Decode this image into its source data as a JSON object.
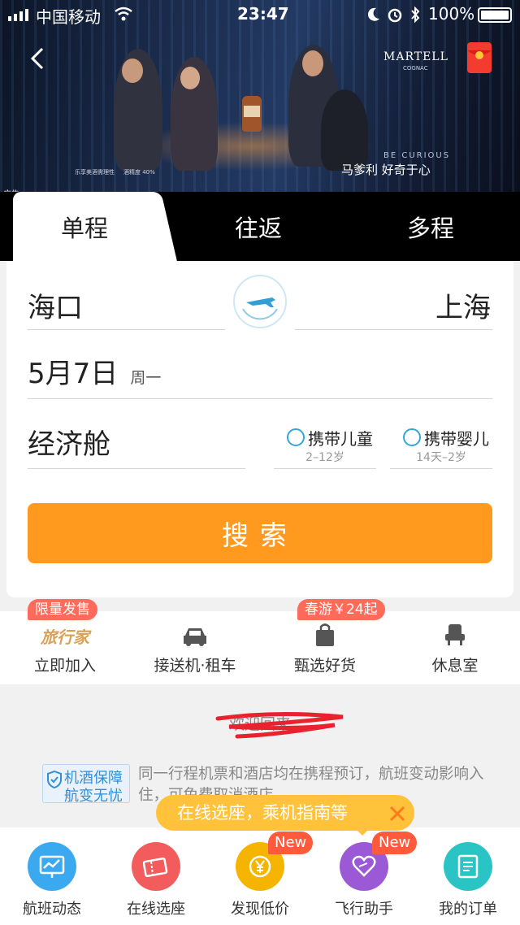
{
  "status_bar": {
    "carrier": "中国移动",
    "time": "23:47",
    "battery": "100%"
  },
  "banner": {
    "brand": "MARTELL",
    "brand_sub": "COGNAC",
    "slogan_en": "BE CURIOUS",
    "slogan_cn": "马爹利 好奇于心",
    "warning": "乐享美酒需理性",
    "abv": "酒精度 40%",
    "ad_tag": "广告"
  },
  "trip_tabs": [
    "单程",
    "往返",
    "多程"
  ],
  "form": {
    "from_city": "海口",
    "to_city": "上海",
    "date": "5月7日",
    "weekday": "周一",
    "cabin": "经济舱",
    "child": {
      "label": "携带儿童",
      "sub": "2–12岁"
    },
    "infant": {
      "label": "携带婴儿",
      "sub": "14天–2岁"
    },
    "search_label": "搜索"
  },
  "promo": {
    "badge1": "限量发售",
    "badge2": "春游￥24起",
    "logo_text": "旅行家"
  },
  "quick_links": [
    {
      "label": "立即加入",
      "icon": "traveler-logo"
    },
    {
      "label": "接送机·租车",
      "icon": "car-icon"
    },
    {
      "label": "甄选好货",
      "icon": "shopping-bag-icon"
    },
    {
      "label": "休息室",
      "icon": "lounge-seat-icon"
    }
  ],
  "welcome": {
    "text": "欢迎回来"
  },
  "guarantee": {
    "badge_line1": "机酒保障",
    "badge_line2": "航变无忧",
    "text": "同一行程机票和酒店均在携程预订，航班变动影响入住，可免费取消酒店"
  },
  "tooltip": {
    "text": "在线选座，乘机指南等"
  },
  "bottom_nav": [
    {
      "label": "航班动态",
      "color": "#3aa9f0",
      "icon": "flight-status-icon"
    },
    {
      "label": "在线选座",
      "color": "#f25c5c",
      "icon": "ticket-icon"
    },
    {
      "label": "发现低价",
      "color": "#f5b400",
      "icon": "yen-coin-icon",
      "badge": "New"
    },
    {
      "label": "飞行助手",
      "color": "#9b59d6",
      "icon": "heart-icon",
      "badge": "New"
    },
    {
      "label": "我的订单",
      "color": "#2bc4c4",
      "icon": "order-icon"
    }
  ]
}
